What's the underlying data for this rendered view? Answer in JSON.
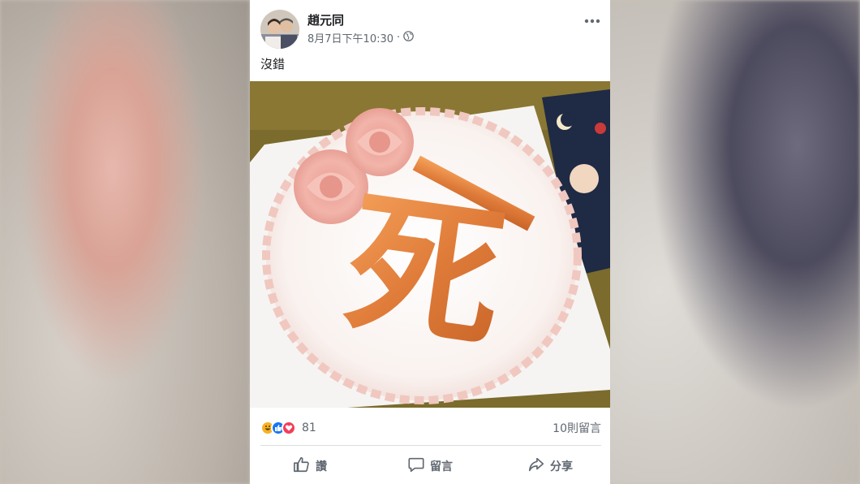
{
  "post": {
    "author": "趙元同",
    "timestamp": "8月7日下午10:30",
    "separator": "·",
    "privacy_icon": "globe-icon",
    "caption": "沒錯",
    "more_icon": "more-dots-icon"
  },
  "photo": {
    "cake_character": "死"
  },
  "reactions": {
    "icons": [
      "haha-icon",
      "like-icon",
      "love-icon"
    ],
    "count": "81",
    "comments": "10則留言"
  },
  "actions": {
    "like_label": "讚",
    "comment_label": "留言",
    "share_label": "分享"
  },
  "colors": {
    "like_blue": "#1877f2",
    "love_red": "#f33e58",
    "haha_yellow": "#f7b125",
    "secondary_text": "#606770"
  }
}
